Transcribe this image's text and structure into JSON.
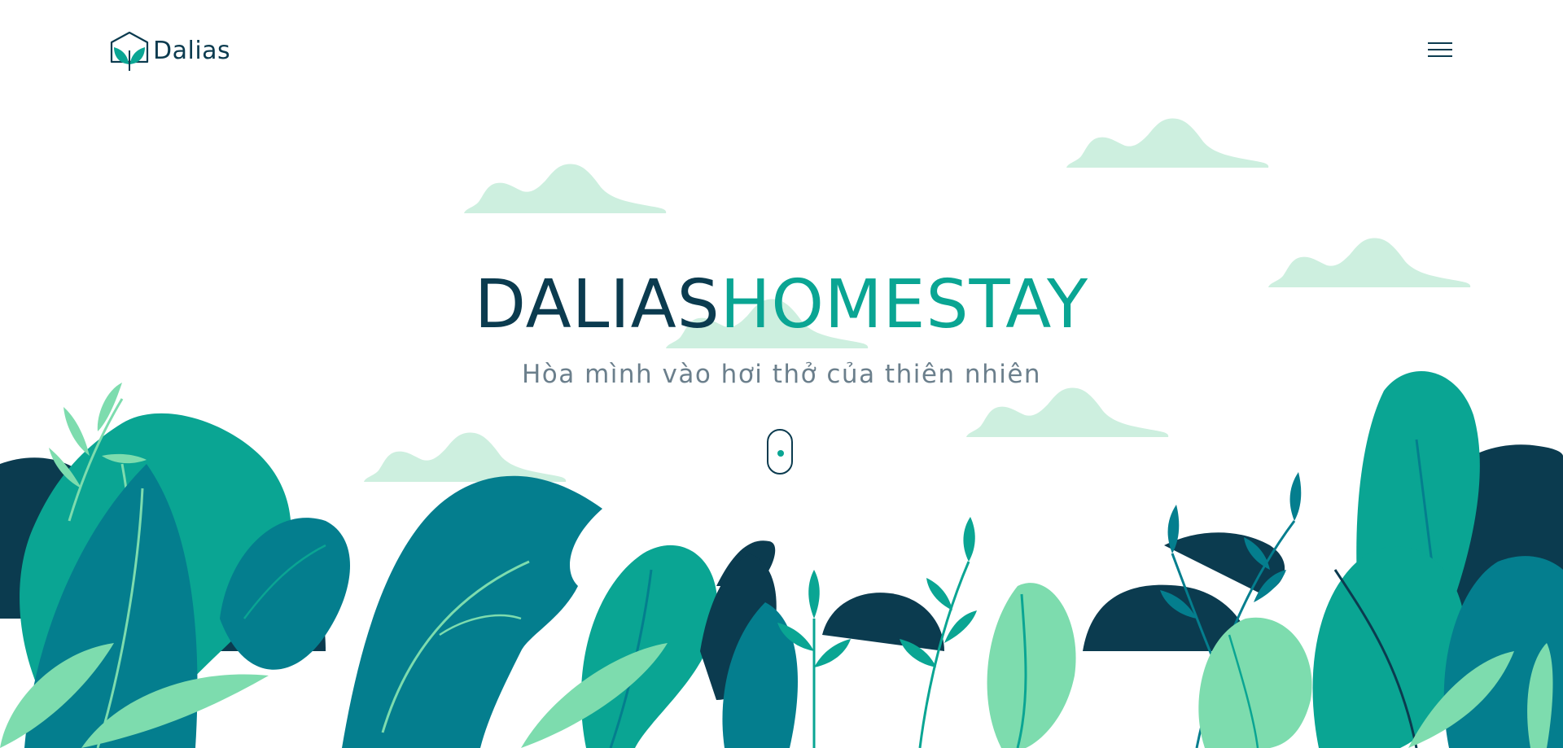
{
  "brand": {
    "name": "Dalias",
    "logo_icon": "leaf-house-icon"
  },
  "header": {
    "menu_icon": "hamburger-menu-icon"
  },
  "hero": {
    "title_part1": "DALIAS",
    "title_part2": "HOMESTAY",
    "subtitle": "Hòa mình vào hơi thở của thiên nhiên",
    "scroll_icon": "mouse-scroll-icon"
  },
  "colors": {
    "navy": "#0b3b4f",
    "teal": "#0aa593",
    "dark_teal": "#047e8e",
    "mint": "#7ddcae",
    "cloud": "#cdefdf",
    "subtitle": "#6b7f8c"
  }
}
